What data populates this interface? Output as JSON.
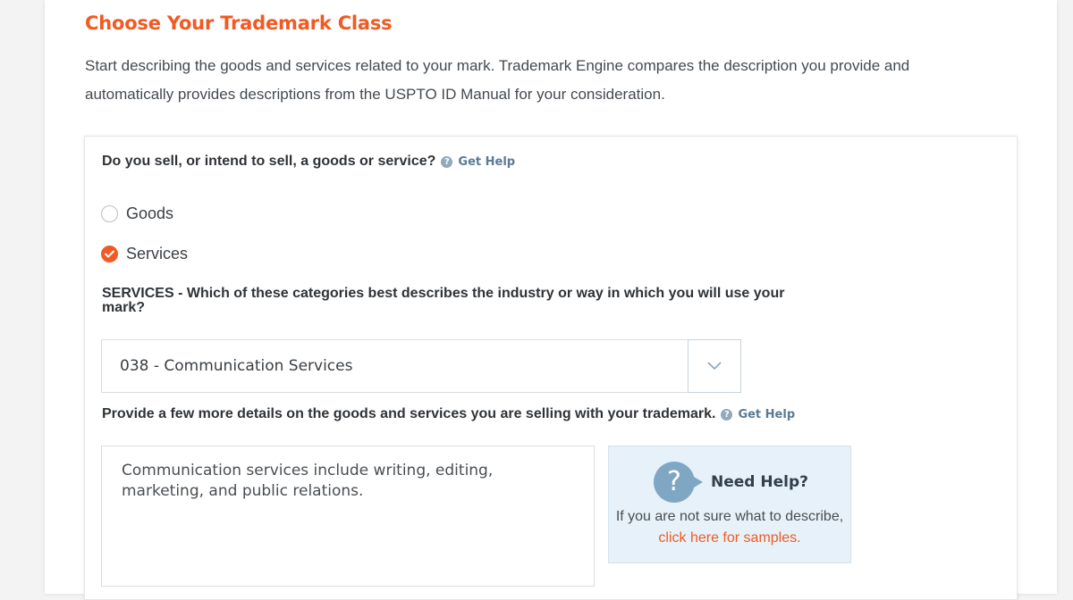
{
  "title": "Choose Your Trademark Class",
  "intro": "Start describing the goods and services related to your mark. Trademark Engine compares the description you provide and automatically provides descriptions from the USPTO ID Manual for your consideration.",
  "question": {
    "label": "Do you sell, or intend to sell, a goods or service?",
    "help": "Get Help"
  },
  "options": [
    {
      "label": "Goods",
      "checked": false
    },
    {
      "label": "Services",
      "checked": true
    }
  ],
  "services_question": "SERVICES - Which of these categories best describes the industry or way in which you will use your mark?",
  "select": {
    "value": "038 - Communication Services"
  },
  "details": {
    "label": "Provide a few more details on the goods and services you are selling with your trademark.",
    "help": "Get Help",
    "value": "Communication services include writing, editing, marketing, and public relations."
  },
  "help_panel": {
    "title": "Need Help?",
    "text": "If you are not sure what to describe,",
    "link": "click here for samples."
  },
  "colors": {
    "accent": "#f15a22",
    "help_blue": "#7fa7c4"
  }
}
